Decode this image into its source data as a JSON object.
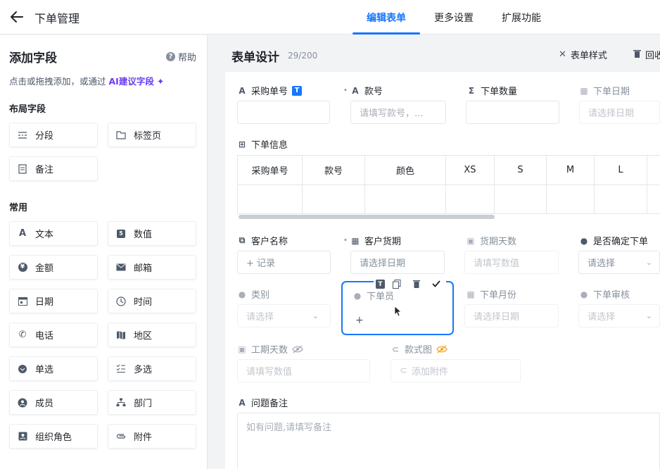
{
  "header": {
    "title": "下单管理",
    "tabs": [
      {
        "label": "编辑表单",
        "active": true
      },
      {
        "label": "更多设置",
        "active": false
      },
      {
        "label": "扩展功能",
        "active": false
      }
    ]
  },
  "sidebar": {
    "title": "添加字段",
    "help": "帮助",
    "hint_prefix": "点击或拖拽添加，或通过",
    "hint_ai": "AI建议字段",
    "sections": {
      "layout": "布局字段",
      "common": "常用"
    },
    "layout_fields": [
      {
        "label": "分段",
        "icon": "section-icon"
      },
      {
        "label": "标签页",
        "icon": "tab-page-icon"
      },
      {
        "label": "备注",
        "icon": "note-icon"
      }
    ],
    "common_fields": [
      {
        "label": "文本",
        "icon": "text-icon"
      },
      {
        "label": "数值",
        "icon": "number-icon"
      },
      {
        "label": "金额",
        "icon": "yen-icon"
      },
      {
        "label": "邮箱",
        "icon": "mail-icon"
      },
      {
        "label": "日期",
        "icon": "calendar-icon"
      },
      {
        "label": "时间",
        "icon": "clock-icon"
      },
      {
        "label": "电话",
        "icon": "phone-icon"
      },
      {
        "label": "地区",
        "icon": "map-icon"
      },
      {
        "label": "单选",
        "icon": "radio-icon"
      },
      {
        "label": "多选",
        "icon": "checklist-icon"
      },
      {
        "label": "成员",
        "icon": "member-icon"
      },
      {
        "label": "部门",
        "icon": "org-icon"
      },
      {
        "label": "组织角色",
        "icon": "role-icon"
      },
      {
        "label": "附件",
        "icon": "paperclip-icon"
      }
    ]
  },
  "form": {
    "title": "表单设计",
    "count": "29/200",
    "style_button": "表单样式",
    "recycle_button": "回收站",
    "fields": {
      "purchase_no": {
        "label": "采购单号",
        "badge": "T"
      },
      "style_no": {
        "label": "款号",
        "placeholder": "请填写款号，..."
      },
      "order_qty": {
        "label": "下单数量"
      },
      "order_date": {
        "label": "下单日期",
        "placeholder": "请选择日期"
      },
      "order_info": {
        "label": "下单信息"
      },
      "customer_name": {
        "label": "客户名称",
        "placeholder": "+ 记录"
      },
      "customer_delivery": {
        "label": "客户货期",
        "placeholder": "请选择日期"
      },
      "delivery_days": {
        "label": "货期天数",
        "placeholder": "请填写数值"
      },
      "confirm_order": {
        "label": "是否确定下单",
        "placeholder": "请选择"
      },
      "category": {
        "label": "类别",
        "placeholder": "请选择"
      },
      "order_person": {
        "label": "下单员",
        "placeholder": "+"
      },
      "order_month": {
        "label": "下单月份",
        "placeholder": "请选择日期"
      },
      "order_review": {
        "label": "下单审核",
        "placeholder": "请选择"
      },
      "work_days": {
        "label": "工期天数",
        "placeholder": "请填写数值"
      },
      "style_image": {
        "label": "款式图",
        "placeholder": "添加附件"
      },
      "issue_note": {
        "label": "问题备注",
        "placeholder": "如有问题,请填写备注"
      }
    },
    "table_columns": [
      "采购单号",
      "款号",
      "颜色",
      "XS",
      "S",
      "M",
      "L"
    ],
    "selected_tools": [
      "T",
      "copy",
      "delete",
      "confirm"
    ]
  },
  "colors": {
    "accent": "#1677ff",
    "ai": "#6a3cf3",
    "hidden_eye": "#f5a623"
  }
}
